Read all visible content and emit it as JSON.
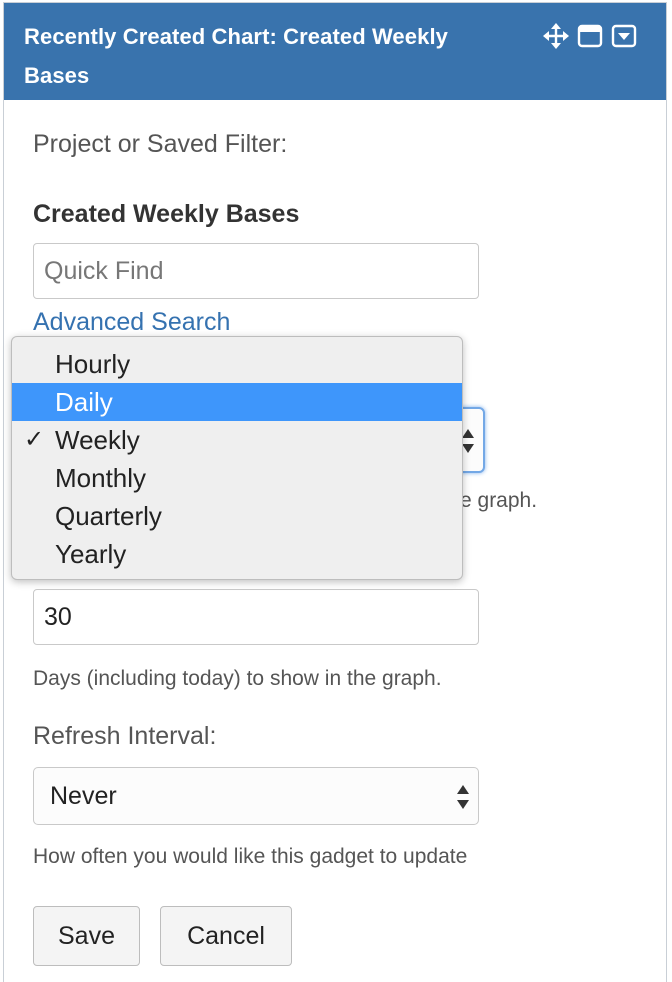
{
  "gadget": {
    "title": "Recently Created Chart: Created Weekly Bases",
    "icons": [
      "move-icon",
      "maximize-icon",
      "menu-dropdown-icon"
    ]
  },
  "form": {
    "project_label": "Project or Saved Filter:",
    "selected_filter": "Created Weekly Bases",
    "quick_find_placeholder": "Quick Find",
    "advanced_search": "Advanced Search",
    "period_help": "e graph.",
    "period_options": [
      "Hourly",
      "Daily",
      "Weekly",
      "Monthly",
      "Quarterly",
      "Yearly"
    ],
    "period_selected": "Weekly",
    "period_highlighted": "Daily",
    "days_value": "30",
    "days_help": "Days (including today) to show in the graph.",
    "refresh_label": "Refresh Interval:",
    "refresh_value": "Never",
    "refresh_help": "How often you would like this gadget to update",
    "check_mark": "✓"
  },
  "buttons": {
    "save": "Save",
    "cancel": "Cancel"
  },
  "colors": {
    "header": "#3973ad",
    "link": "#3572b0",
    "highlight": "#3e96fb"
  }
}
